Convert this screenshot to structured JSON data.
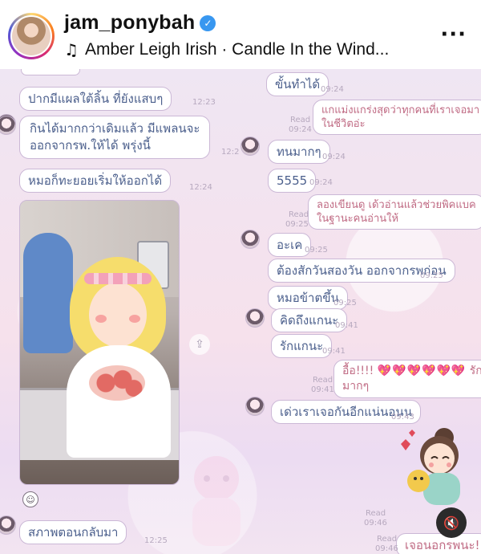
{
  "post_header": {
    "username": "jam_ponybah",
    "verified_icon": "verified-check-icon",
    "music_icon": "music-note-icon",
    "music_text": "Amber Leigh Irish · Candle In the Wind...",
    "more_icon": "more-options-icon"
  },
  "chat": {
    "messages_left": [
      {
        "text": "ปากมีแผลใต้ลิ้น ที่ยังแสบๆ",
        "time": "12:23"
      },
      {
        "text": "กินได้มากกว่าเดิมแล้ว มีแพลนจะ",
        "text2": "ออกจากรพ.ให้ได้ พรุ่งนี้",
        "time": "12:2"
      },
      {
        "text": "หมอก็ทะยอยเริ่มให้ออกได้",
        "time": "12:24"
      },
      {
        "text": "สภาพตอนกลับมา",
        "time": "12:25"
      }
    ],
    "messages_right": [
      {
        "text": "ขั้นทำได้",
        "time": "09:24"
      },
      {
        "text": "แกแม่งแกร่งสุดว่าทุกคนที่เราเจอมา",
        "text2": "ในชีวิตอ่ะ",
        "read": "Read",
        "time": "09:24"
      },
      {
        "text": "ทนมากๆ",
        "time": "09:24"
      },
      {
        "text": "5555",
        "time": "09:24"
      },
      {
        "text": "ลองเขียนดู เด้วอ่านแล้วช่วยพิคแบค",
        "text2": "ในฐานะคนอ่านให้",
        "read": "Read",
        "time": "09:25"
      },
      {
        "text": "อะเค",
        "time": "09:25"
      },
      {
        "text": "ต้องสักวันสองวัน ออกจากรพก่อน",
        "time": "09:25"
      },
      {
        "text": "หมอข้าตขึ้น",
        "time": "09:25"
      },
      {
        "text": "คิดถึงแกนะ",
        "time": "09:41"
      },
      {
        "text": "รักแกนะ",
        "time": "09:41"
      },
      {
        "text": "อื้อ!!!!",
        "hearts": "💖💖💖💖💖💖",
        "text_end": "รัก",
        "text2": "มากๆ",
        "read": "Read",
        "time": "09:41"
      },
      {
        "text": "เด่วเราเจอกันอีกแน่นอนน",
        "time": "09:43"
      },
      {
        "text": "เจอนอกรพนะ!",
        "read": "Read",
        "read2": "Read",
        "time_a": "09:46",
        "time": "09:46"
      }
    ]
  }
}
